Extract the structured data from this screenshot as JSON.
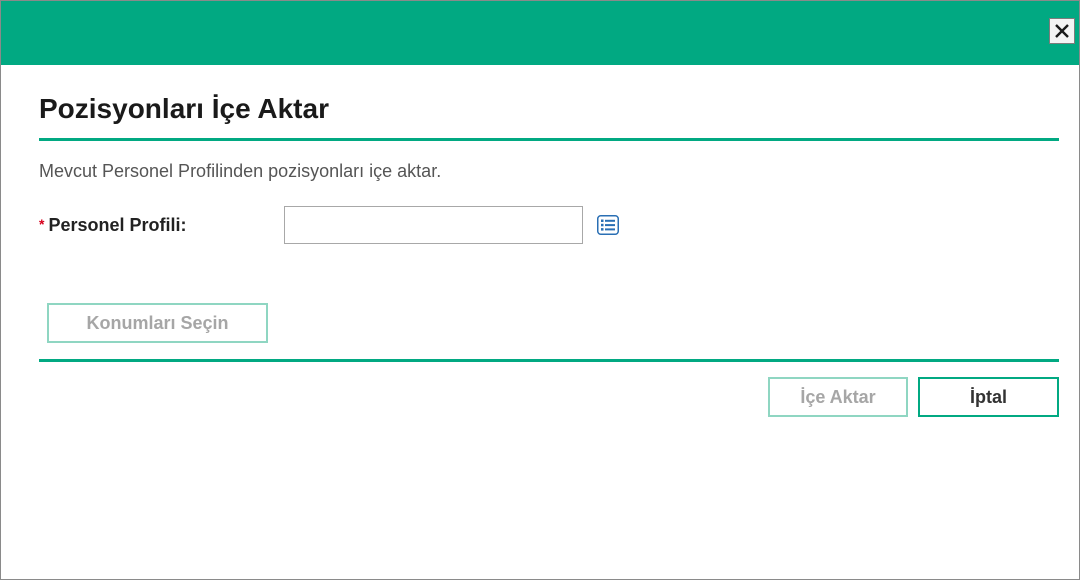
{
  "dialog": {
    "title": "Pozisyonları İçe Aktar",
    "description": "Mevcut Personel Profilinden pozisyonları içe aktar.",
    "close_icon": "close-icon"
  },
  "form": {
    "required_marker": "*",
    "profile_label": "Personel Profili:",
    "profile_value": "",
    "profile_placeholder": "",
    "lookup_icon": "list-lookup-icon"
  },
  "buttons": {
    "select_locations": "Konumları Seçin",
    "import": "İçe Aktar",
    "cancel": "İptal"
  },
  "colors": {
    "accent": "#01a982",
    "required": "#d6001c",
    "lookup_icon": "#2a6fb4"
  }
}
